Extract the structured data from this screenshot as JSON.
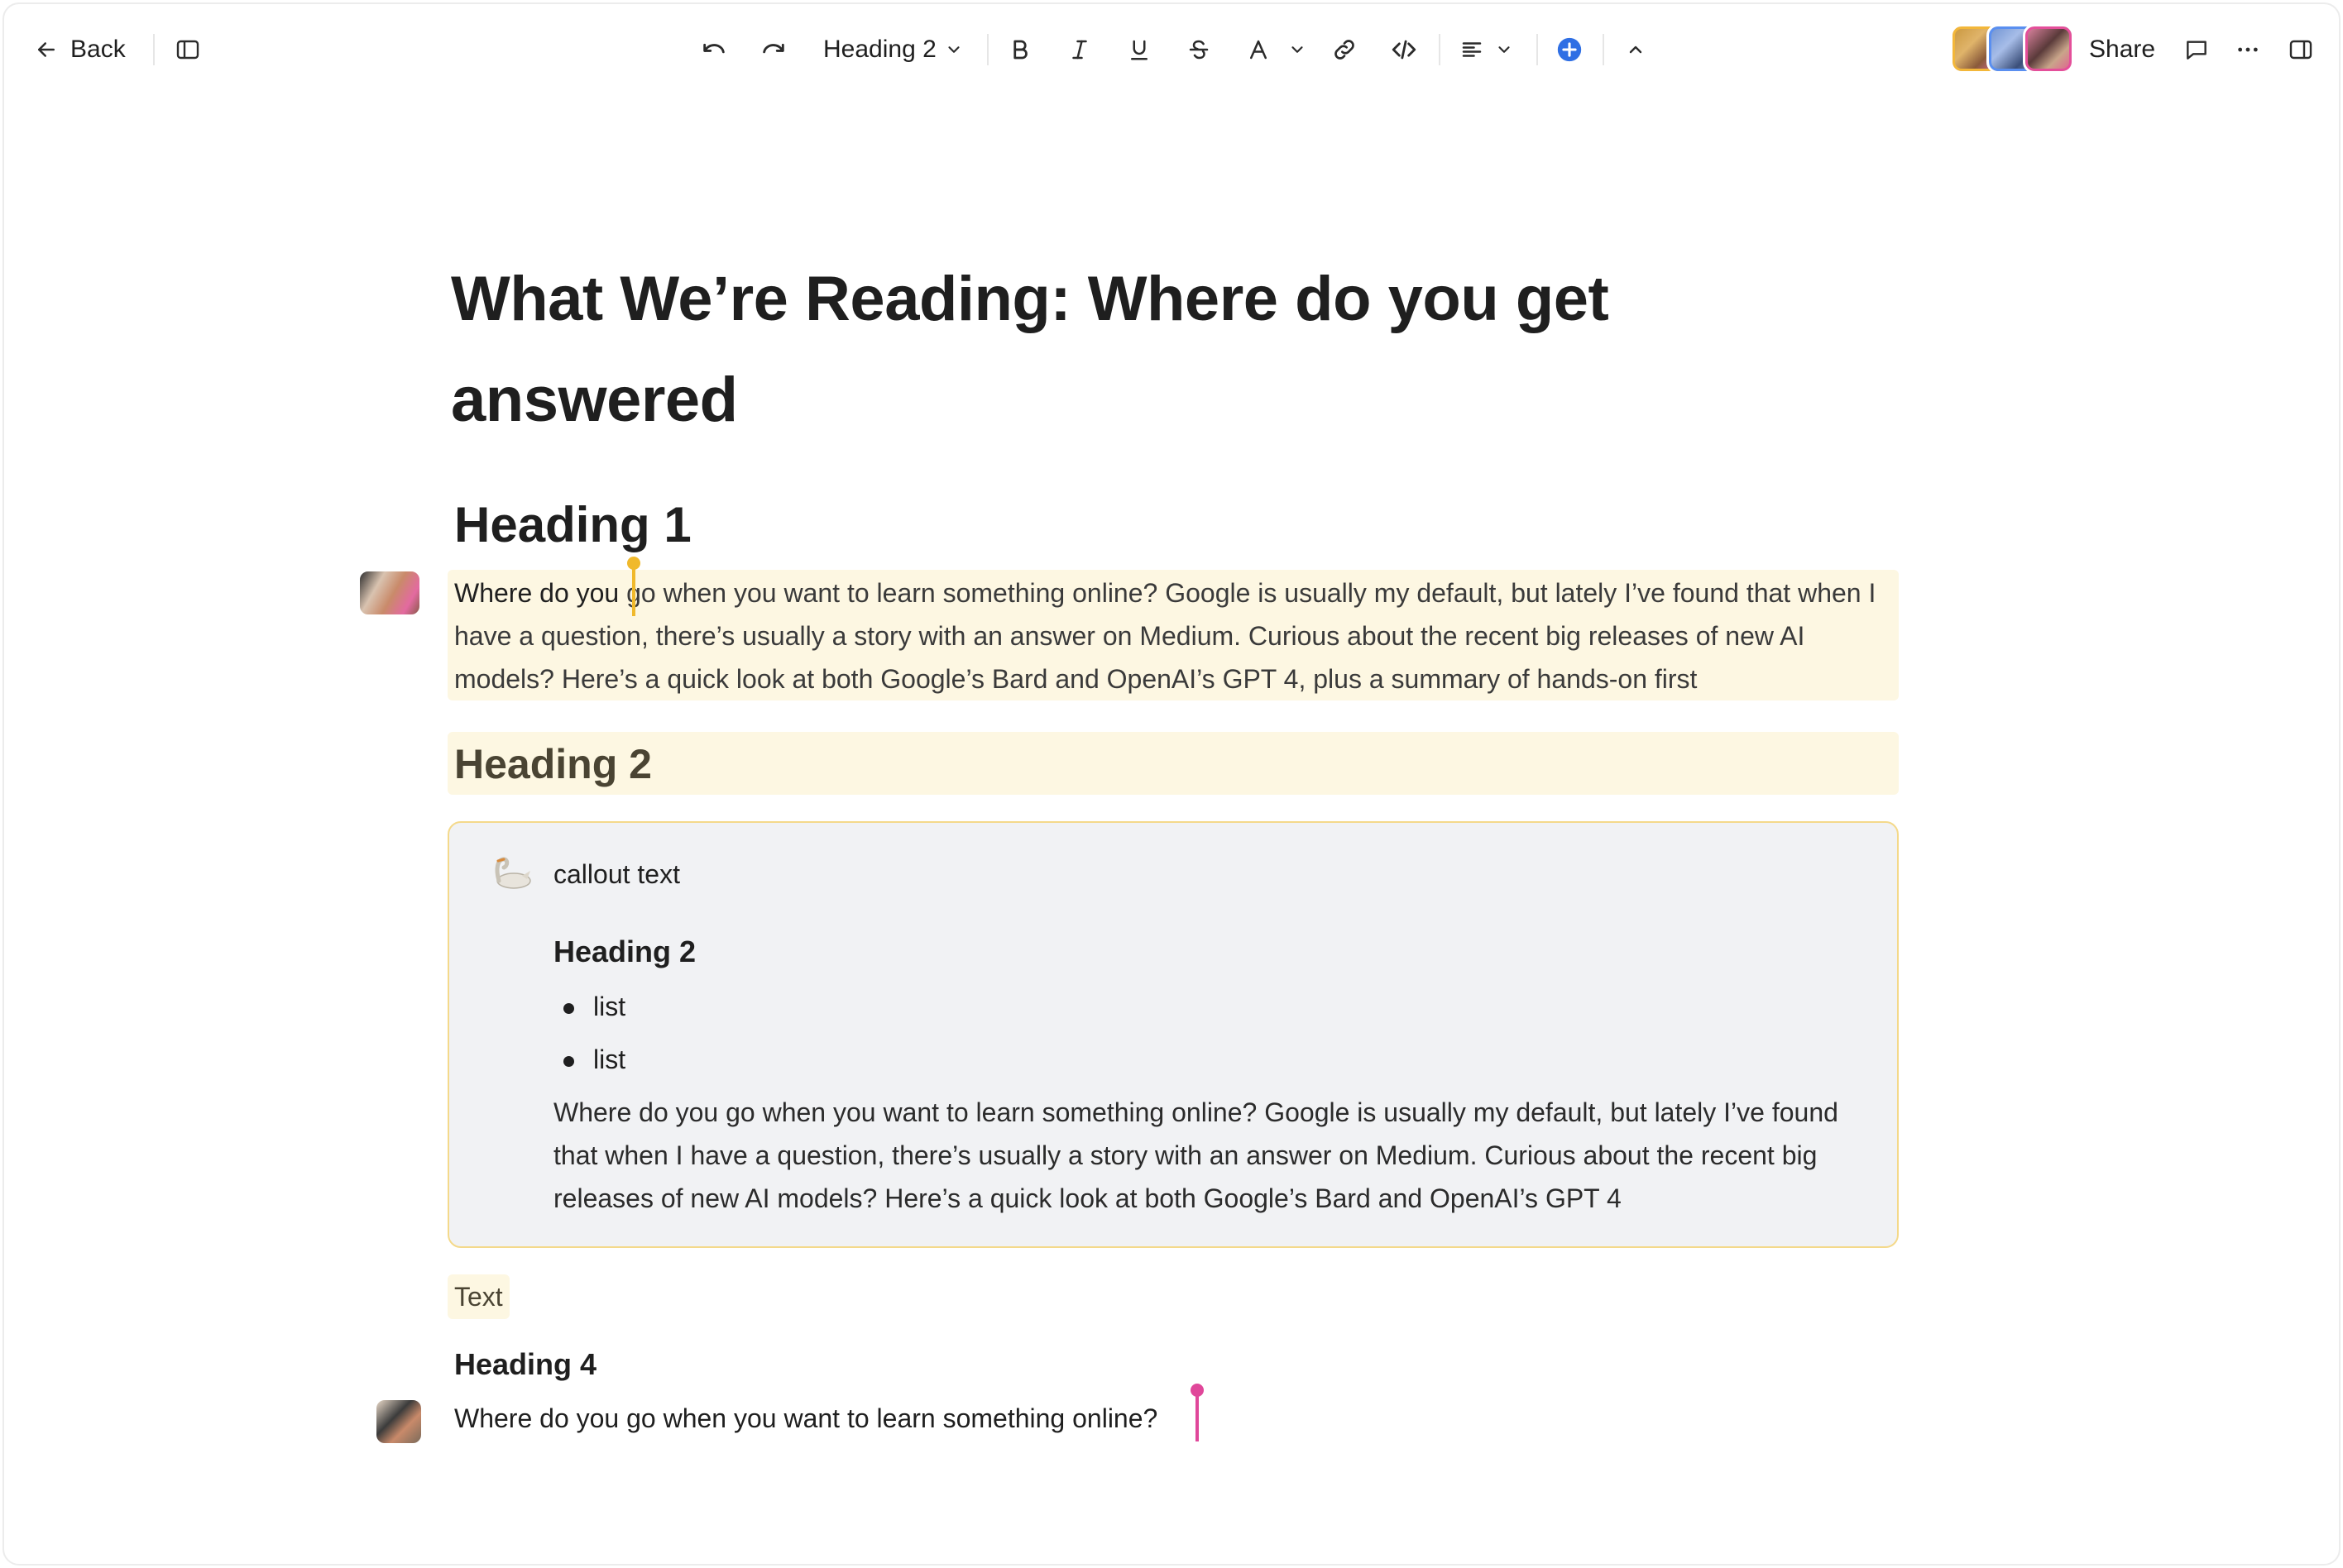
{
  "toolbar": {
    "back_label": "Back",
    "heading_style": "Heading 2",
    "share_label": "Share",
    "icons": {
      "back": "arrow-left-icon",
      "sidebar": "sidebar-toggle-icon",
      "undo": "undo-icon",
      "redo": "redo-icon",
      "bold": "bold-icon",
      "italic": "italic-icon",
      "underline": "underline-icon",
      "strikethrough": "strikethrough-icon",
      "text_color": "text-color-icon",
      "link": "link-icon",
      "code": "code-icon",
      "align": "align-left-icon",
      "insert": "plus-circle-icon",
      "collapse": "chevron-up-icon",
      "comment": "comment-icon",
      "more": "more-horizontal-icon",
      "panel": "right-panel-icon"
    },
    "colors": {
      "insert_accent": "#2f6fe4"
    }
  },
  "document": {
    "title": "What We’re Reading: Where do you get answered",
    "heading1": "Heading 1",
    "paragraph1_lead": "Where do you ",
    "paragraph1_rest": "go when you want to learn something online? Google is usually my default, but lately I’ve found that when I have a question, there’s usually a story with an answer on Medium. Curious about the recent big releases of new AI models? Here’s a quick look at both Google’s Bard and OpenAI’s GPT 4, plus a summary of hands-on first",
    "heading2": "Heading 2",
    "callout": {
      "icon": "swan-icon",
      "text": "callout text",
      "heading": "Heading 2",
      "list": [
        "list",
        "list"
      ],
      "paragraph": "Where do you go when you want to learn something online? Google is usually my default, but lately I’ve found that when I have a question, there’s usually a story with an answer on Medium. Curious about the recent big releases of new AI models? Here’s a quick look at both Google’s Bard and OpenAI’s GPT 4"
    },
    "text_block": "Text",
    "heading4": "Heading 4",
    "paragraph2": "Where do you go when you want to learn something online?"
  },
  "collaborators": {
    "cursor_colors": [
      "#f0b92c",
      "#e0479a"
    ],
    "highlight_color": "#fdf7e2"
  }
}
